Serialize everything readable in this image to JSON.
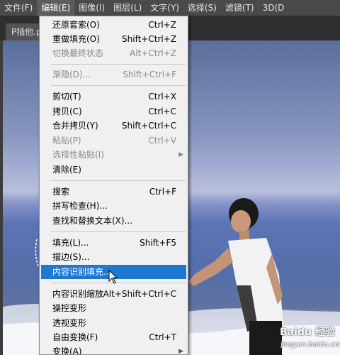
{
  "menubar": {
    "items": [
      {
        "label": "文件(F)",
        "active": false
      },
      {
        "label": "编辑(E)",
        "active": true
      },
      {
        "label": "图像(I)",
        "active": false
      },
      {
        "label": "图层(L)",
        "active": false
      },
      {
        "label": "文字(Y)",
        "active": false
      },
      {
        "label": "选择(S)",
        "active": false
      },
      {
        "label": "滤镜(T)",
        "active": false
      },
      {
        "label": "3D(D",
        "active": false
      }
    ]
  },
  "document": {
    "tab_title": "P插他.p"
  },
  "edit_menu": {
    "items": [
      {
        "label": "还原套索(O)",
        "shortcut": "Ctrl+Z",
        "disabled": false
      },
      {
        "label": "重做填充(O)",
        "shortcut": "Shift+Ctrl+Z",
        "disabled": false
      },
      {
        "label": "切换最终状态",
        "shortcut": "Alt+Ctrl+Z",
        "disabled": true
      },
      {
        "label": "渐隐(D)...",
        "shortcut": "Shift+Ctrl+F",
        "disabled": true
      },
      {
        "label": "剪切(T)",
        "shortcut": "Ctrl+X",
        "disabled": false
      },
      {
        "label": "拷贝(C)",
        "shortcut": "Ctrl+C",
        "disabled": false
      },
      {
        "label": "合并拷贝(Y)",
        "shortcut": "Shift+Ctrl+C",
        "disabled": false
      },
      {
        "label": "粘贴(P)",
        "shortcut": "Ctrl+V",
        "disabled": true
      },
      {
        "label": "选择性粘贴(I)",
        "shortcut": "",
        "disabled": true,
        "submenu": true
      },
      {
        "label": "清除(E)",
        "shortcut": "",
        "disabled": false
      },
      {
        "label": "搜索",
        "shortcut": "Ctrl+F",
        "disabled": false
      },
      {
        "label": "拼写检查(H)...",
        "shortcut": "",
        "disabled": false
      },
      {
        "label": "查找和替换文本(X)...",
        "shortcut": "",
        "disabled": false
      },
      {
        "label": "填充(L)...",
        "shortcut": "Shift+F5",
        "disabled": false
      },
      {
        "label": "描边(S)...",
        "shortcut": "",
        "disabled": false
      },
      {
        "label": "内容识别填充...",
        "shortcut": "",
        "disabled": false,
        "highlighted": true
      },
      {
        "label": "内容识别缩放",
        "shortcut": "Alt+Shift+Ctrl+C",
        "disabled": false
      },
      {
        "label": "操控变形",
        "shortcut": "",
        "disabled": false
      },
      {
        "label": "透视变形",
        "shortcut": "",
        "disabled": false
      },
      {
        "label": "自由变换(F)",
        "shortcut": "Ctrl+T",
        "disabled": false
      },
      {
        "label": "变换(A)",
        "shortcut": "",
        "disabled": false,
        "submenu": true
      }
    ]
  },
  "watermark": {
    "brand": "Baidu 经验",
    "url": "jingyan.baidu.com"
  },
  "colors": {
    "menu_bg": "#f0f0f0",
    "highlight": "#1e78d2",
    "menubar_bg": "#4a4a4a"
  }
}
